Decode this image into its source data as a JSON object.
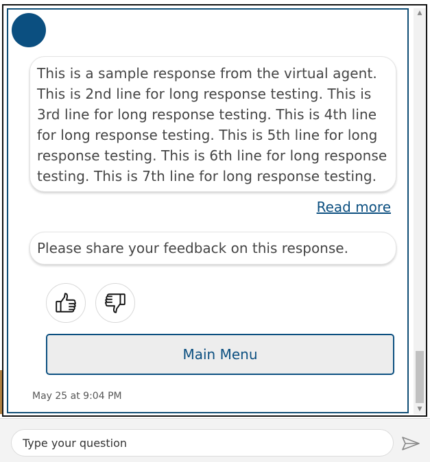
{
  "transcript": {
    "message_text": "This is a sample response from the virtual agent. This is 2nd line for long response testing. This is 3rd line for long response testing. This is 4th line for long response testing. This is 5th line for long response testing. This is 6th line for long response testing. This is 7th line for long response testing.",
    "read_more_label": "Read more",
    "feedback_prompt": "Please share your feedback on this response.",
    "main_menu_label": "Main Menu",
    "timestamp": "May 25 at 9:04 PM"
  },
  "icons": {
    "avatar": "bot-avatar",
    "thumbs_up": "thumbs-up-icon",
    "thumbs_down": "thumbs-down-icon",
    "send": "send-icon"
  },
  "input": {
    "placeholder": "Type your question",
    "value": ""
  },
  "colors": {
    "accent": "#0b4f80",
    "border": "#0f4d75",
    "button_bg": "#ededed"
  }
}
